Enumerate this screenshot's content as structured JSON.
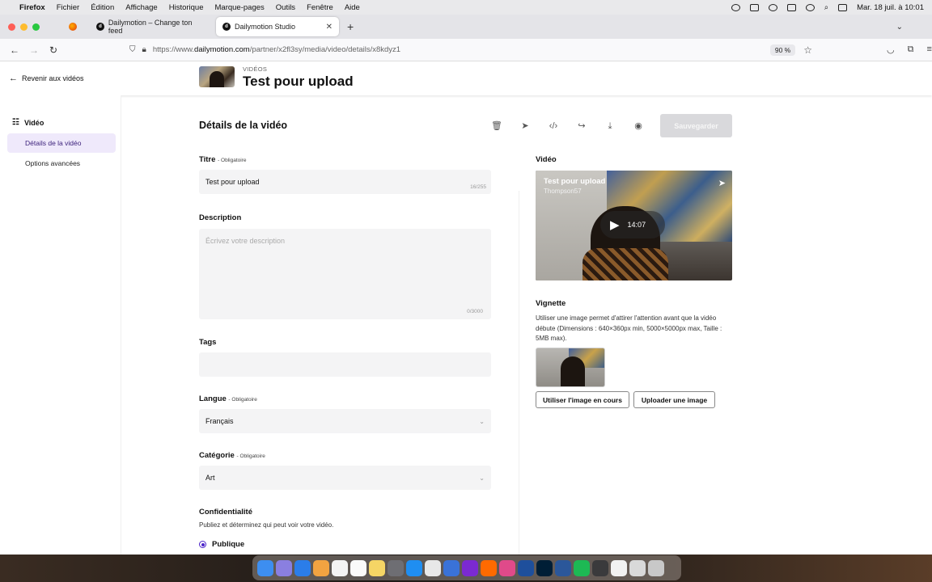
{
  "menubar": {
    "app": "Firefox",
    "items": [
      "Fichier",
      "Édition",
      "Affichage",
      "Historique",
      "Marque-pages",
      "Outils",
      "Fenêtre",
      "Aide"
    ],
    "clock": "Mar. 18 juil. à 10:01"
  },
  "tabs": [
    {
      "label": "Dailymotion – Change ton feed",
      "active": false
    },
    {
      "label": "Dailymotion Studio",
      "active": true
    }
  ],
  "address": {
    "prefix": "https://www.",
    "domain": "dailymotion.com",
    "path": "/partner/x2fl3sy/media/video/details/x8kdyz1",
    "zoom": "90 %"
  },
  "header": {
    "back_label": "Revenir aux vidéos",
    "kicker": "VIDÉOS",
    "title": "Test pour upload"
  },
  "sidebar": {
    "section": "Vidéo",
    "items": [
      {
        "label": "Détails de la vidéo",
        "active": true
      },
      {
        "label": "Options avancées",
        "active": false
      }
    ]
  },
  "main": {
    "title": "Détails de la vidéo",
    "save_label": "Sauvegarder",
    "required_suffix": "- Obligatoire",
    "title_field": {
      "label": "Titre",
      "value": "Test pour upload",
      "counter": "16/255"
    },
    "description": {
      "label": "Description",
      "placeholder": "Écrivez votre description",
      "counter": "0/3000"
    },
    "tags": {
      "label": "Tags",
      "value": ""
    },
    "language": {
      "label": "Langue",
      "value": "Français"
    },
    "category": {
      "label": "Catégorie",
      "value": "Art"
    },
    "privacy": {
      "label": "Confidentialité",
      "help": "Publiez et déterminez qui peut voir votre vidéo.",
      "option": "Publique"
    }
  },
  "video_panel": {
    "label": "Vidéo",
    "overlay_title": "Test pour upload",
    "overlay_author": "Thompson57",
    "duration": "14:07"
  },
  "thumbnail": {
    "label": "Vignette",
    "help": "Utiliser une image permet d'attirer l'attention avant que la vidéo débute (Dimensions : 640×360px min, 5000×5000px max, Taille : 5MB max).",
    "use_current_label": "Utiliser l'image en cours",
    "upload_label": "Uploader une image"
  },
  "colors": {
    "accent": "#4b24c9",
    "active_nav_bg": "#efe9fb",
    "save_disabled": "#d9d9dc"
  }
}
